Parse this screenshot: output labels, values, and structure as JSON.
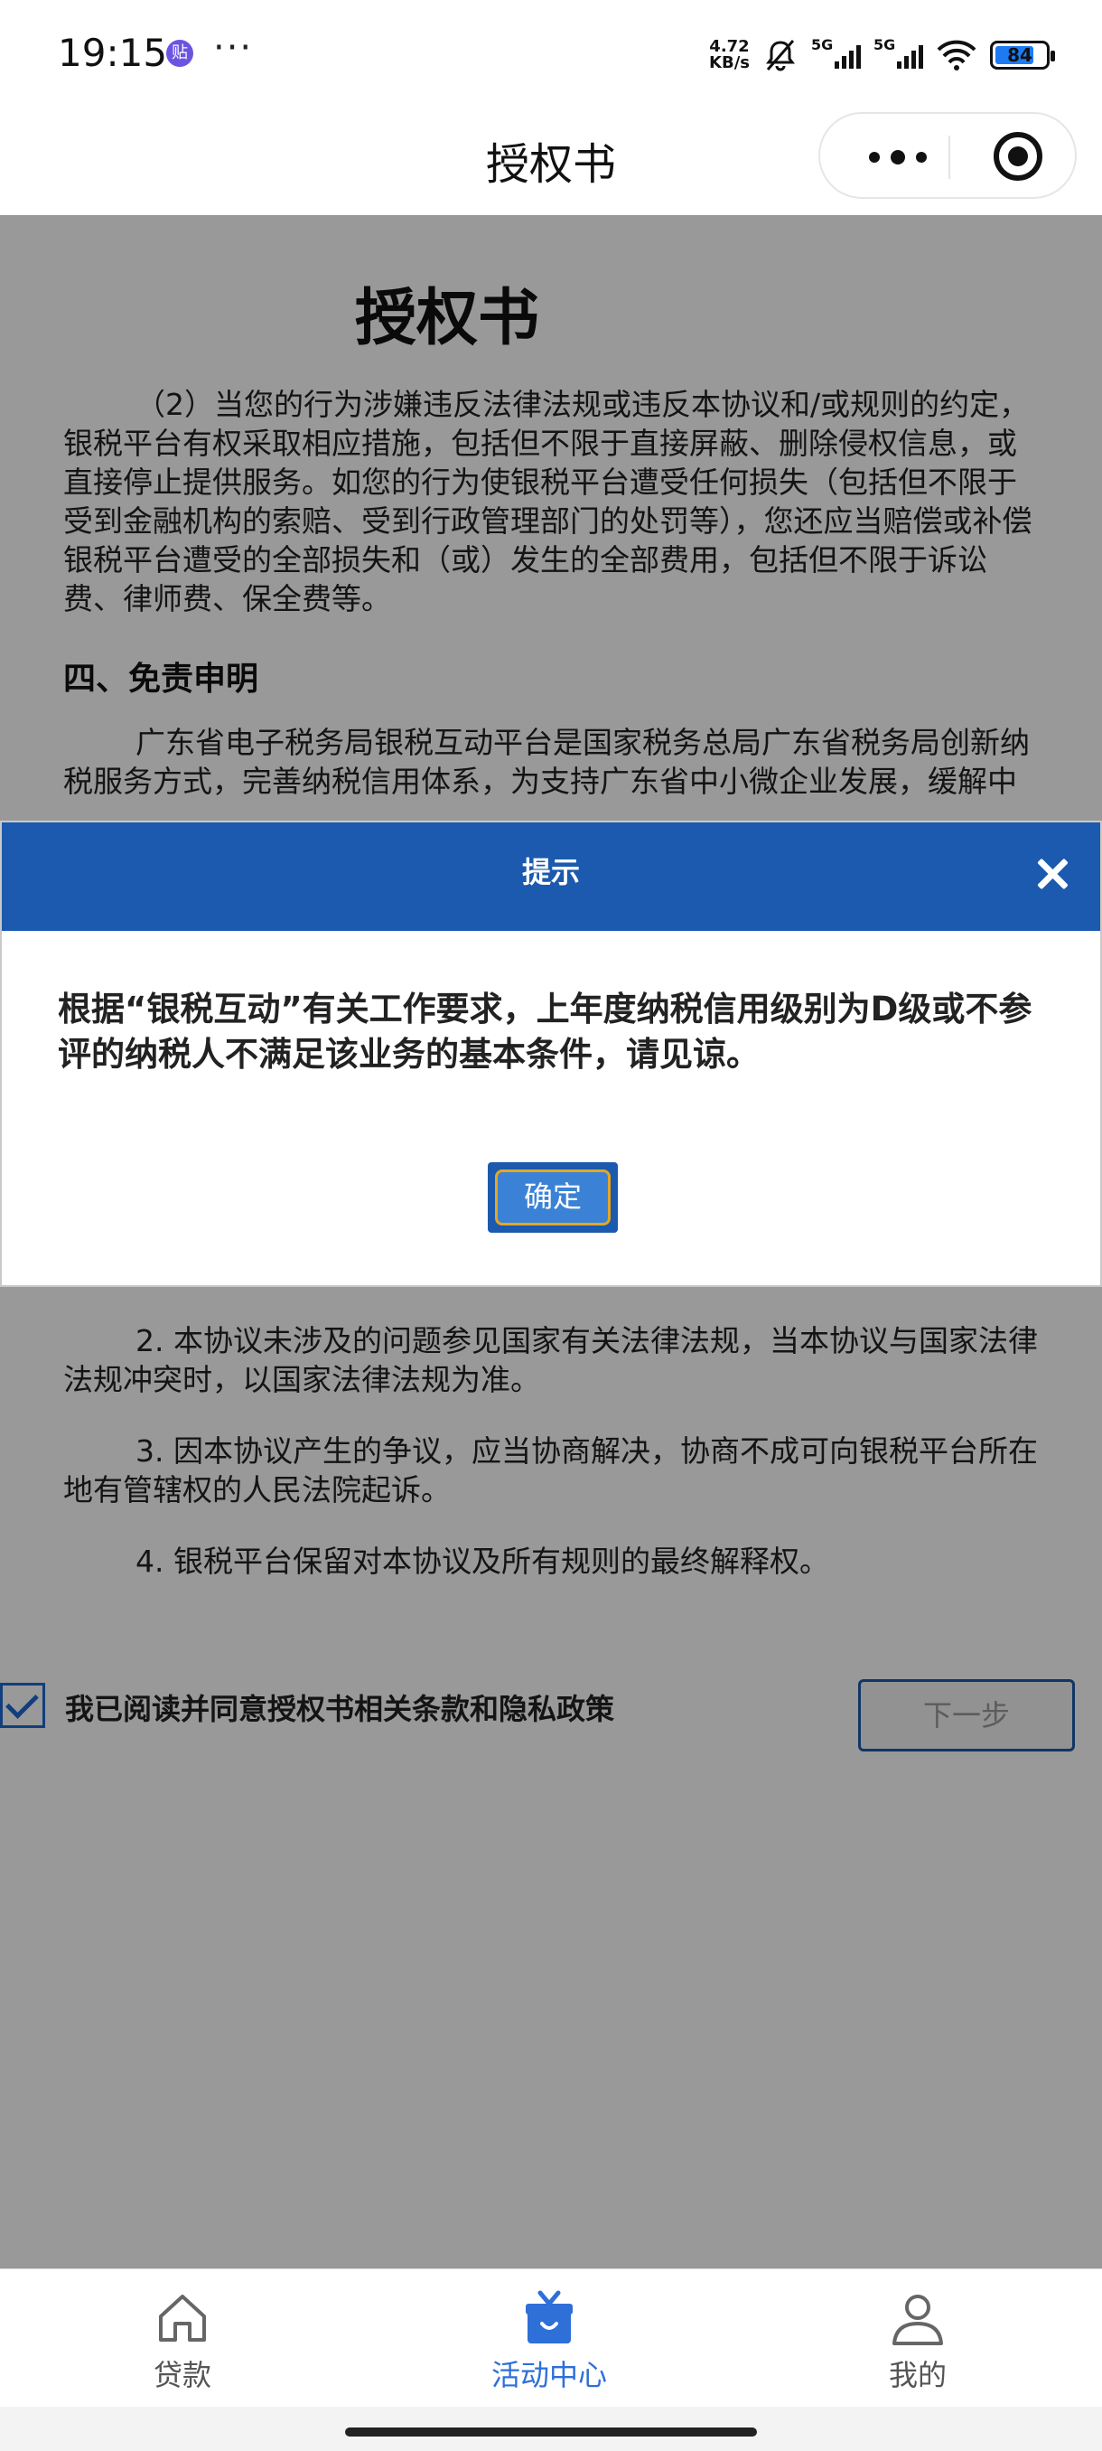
{
  "status_bar": {
    "time": "19:15",
    "app_badge": "贴",
    "more": "···",
    "speed_value": "4.72",
    "speed_unit": "KB/s",
    "signal_label": "5G",
    "battery": "84"
  },
  "nav": {
    "title": "授权书"
  },
  "document": {
    "title": "授权书",
    "para1": "（2）当您的行为涉嫌违反法律法规或违反本协议和/或规则的约定，银税平台有权采取相应措施，包括但不限于直接屏蔽、删除侵权信息，或直接停止提供服务。如您的行为使银税平台遭受任何损失（包括但不限于受到金融机构的索赔、受到行政管理部门的处罚等），您还应当赔偿或补偿银税平台遭受的全部损失和（或）发生的全部费用，包括但不限于诉讼费、律师费、保全费等。",
    "heading4": "四、免责申明",
    "para2": "广东省电子税务局银税互动平台是国家税务总局广东省税务局创新纳税服务方式，完善纳税信用体系，为支持广东省中小微企业发展，缓解中小微企业融资难、融资贵问题而构建的银税服务平台，平台是以服务纳",
    "item2": "2. 本协议未涉及的问题参见国家有关法律法规，当本协议与国家法律法规冲突时，以国家法律法规为准。",
    "item3": "3. 因本协议产生的争议，应当协商解决，协商不成可向银税平台所在地有管辖权的人民法院起诉。",
    "item4": "4. 银税平台保留对本协议及所有规则的最终解释权。"
  },
  "agreement": {
    "label": "我已阅读并同意授权书相关条款和隐私政策",
    "checked": true,
    "next_label": "下一步"
  },
  "dialog": {
    "title": "提示",
    "message": "根据“银税互动”有关工作要求，上年度纳税信用级别为D级或不参评的纳税人不满足该业务的基本条件，请见谅。",
    "ok_label": "确定"
  },
  "tabbar": {
    "items": [
      {
        "label": "贷款",
        "icon": "home-icon"
      },
      {
        "label": "活动中心",
        "icon": "gift-icon",
        "active": true
      },
      {
        "label": "我的",
        "icon": "user-icon"
      }
    ]
  },
  "colors": {
    "primary": "#1b5aae",
    "tab_active": "#2e6fd8",
    "button_focus_border": "#e5a622"
  }
}
